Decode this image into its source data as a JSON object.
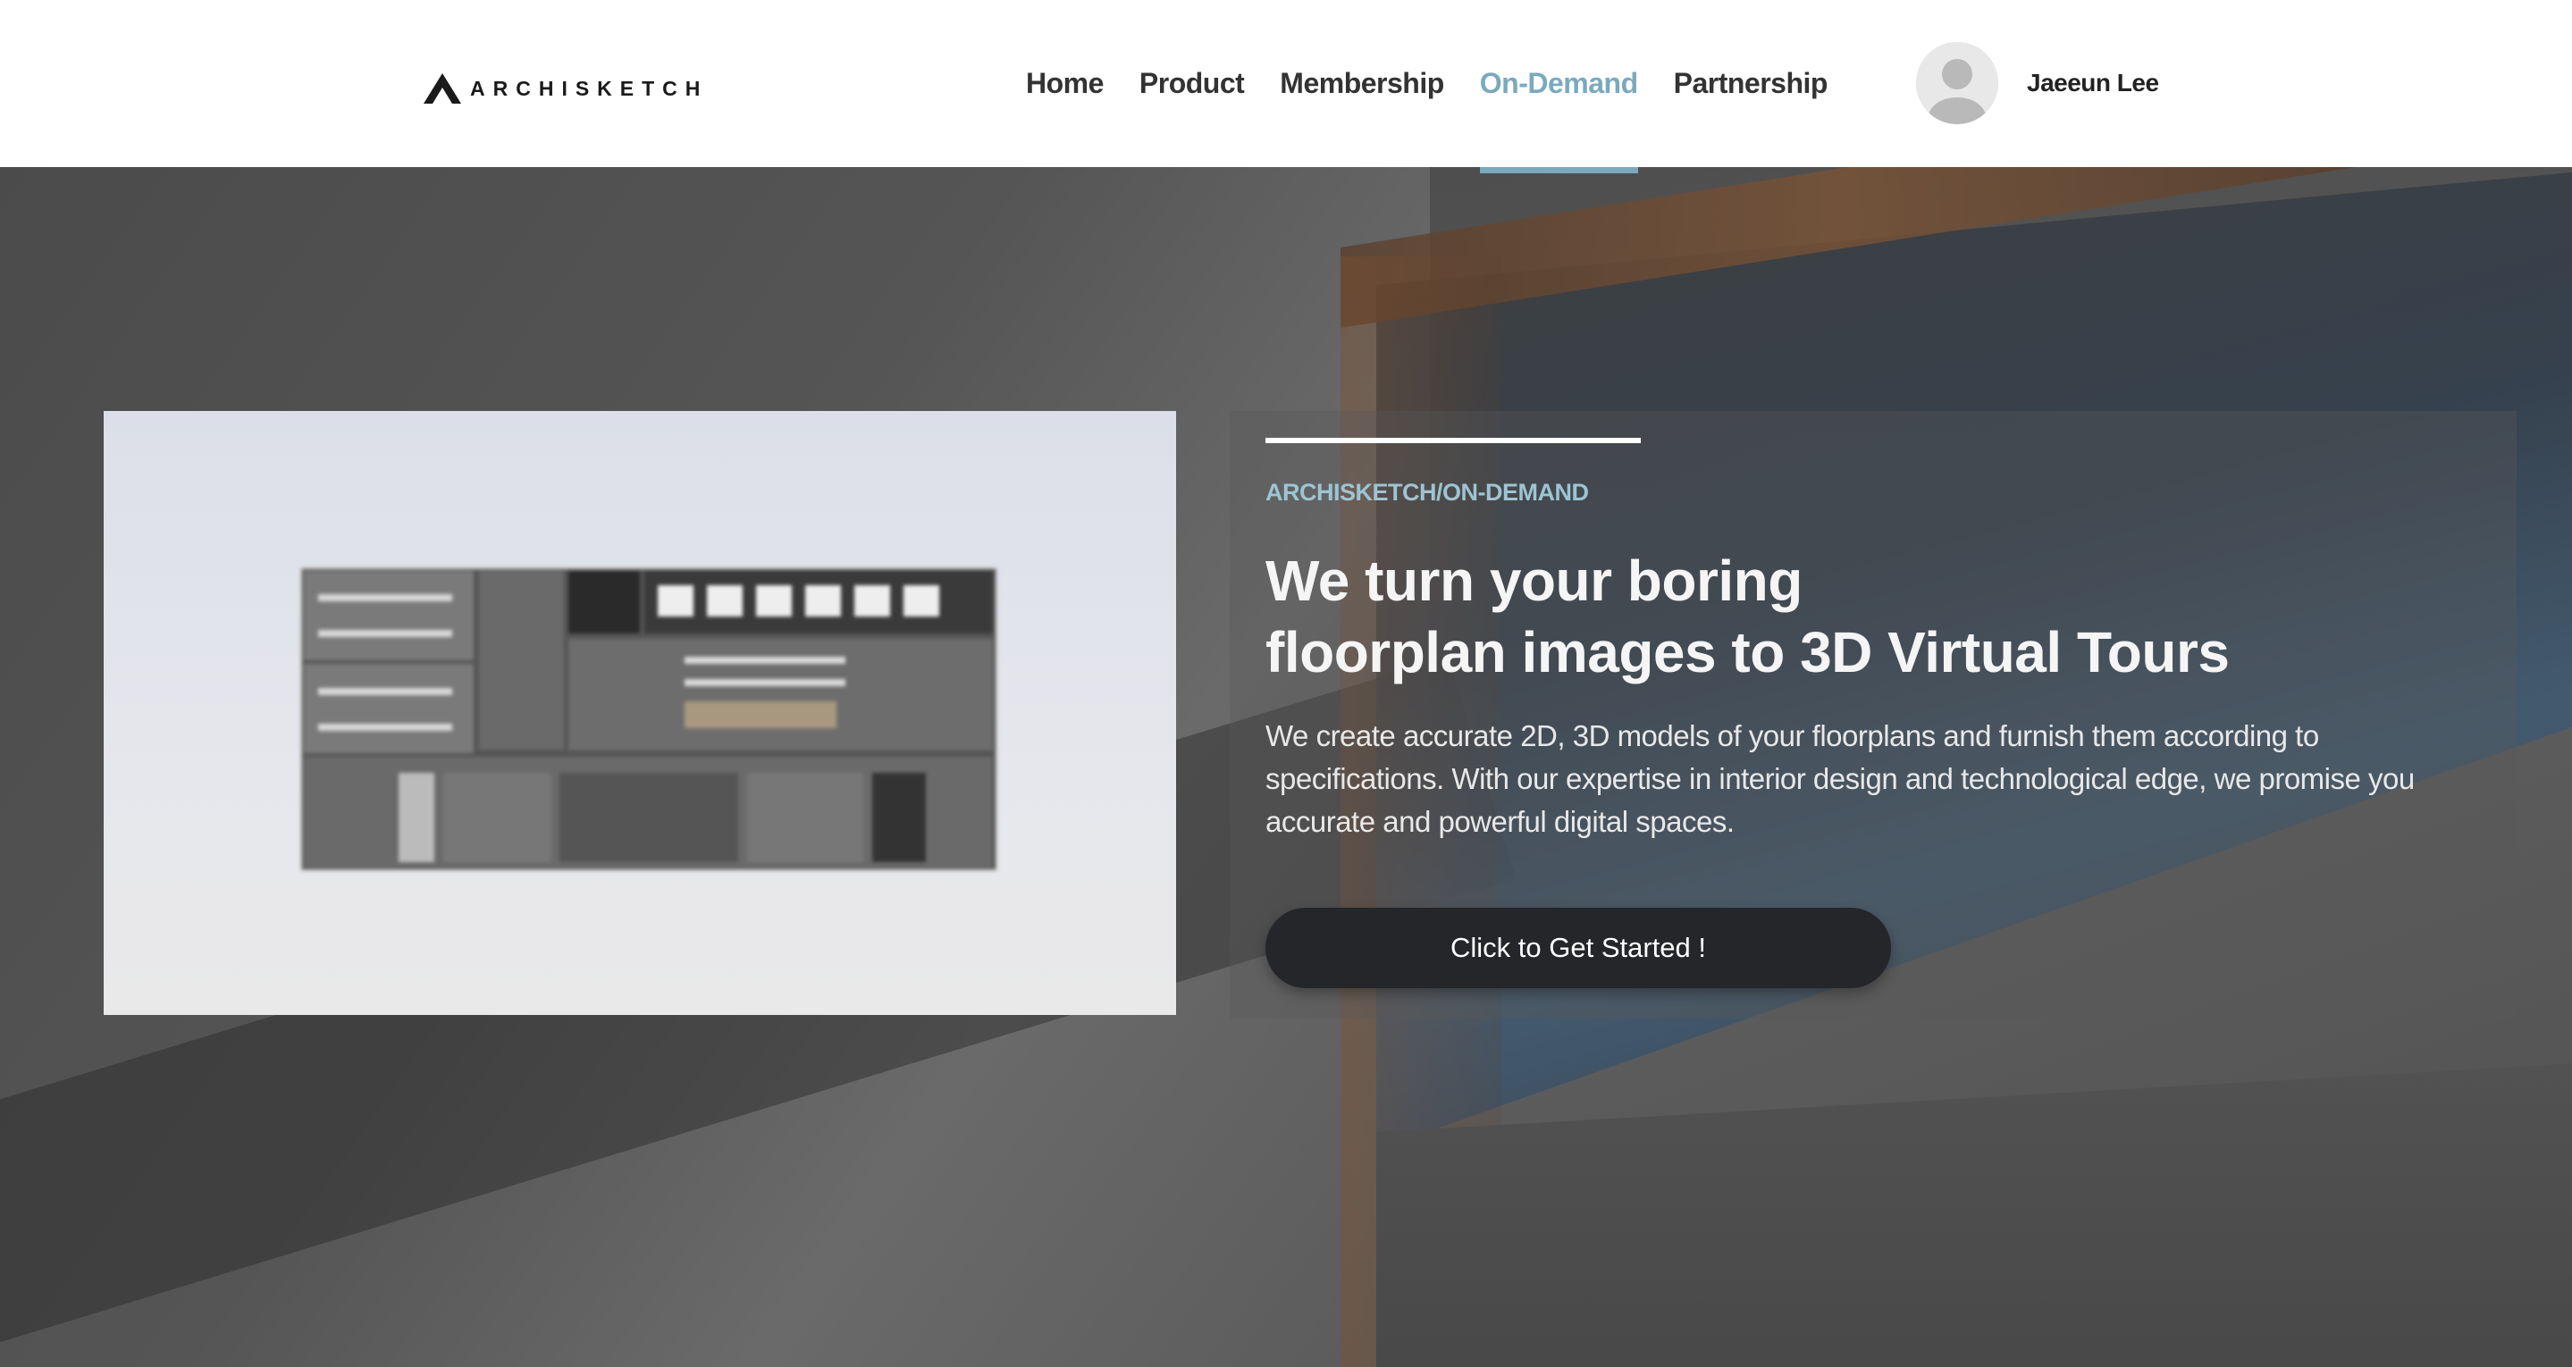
{
  "brand": {
    "name": "ARCHISKETCH"
  },
  "nav": {
    "items": [
      {
        "label": "Home",
        "active": false
      },
      {
        "label": "Product",
        "active": false
      },
      {
        "label": "Membership",
        "active": false
      },
      {
        "label": "On-Demand",
        "active": true
      },
      {
        "label": "Partnership",
        "active": false
      }
    ]
  },
  "user": {
    "name": "Jaeeun Lee",
    "avatar_icon": "user-avatar-icon"
  },
  "hero": {
    "eyebrow": "ARCHISKETCH/ON-DEMAND",
    "title_line1": "We turn your boring",
    "title_line2": "floorplan images to 3D Virtual Tours",
    "description": "We create accurate 2D, 3D models of your floorplans and furnish them according to specifications. With our expertise in interior design and technological edge, we promise you accurate and powerful digital spaces.",
    "cta_label": "Click to Get Started !"
  },
  "colors": {
    "accent": "#7aa9bd",
    "eyebrow": "#9ec4d3",
    "cta_bg": "#24262a"
  }
}
